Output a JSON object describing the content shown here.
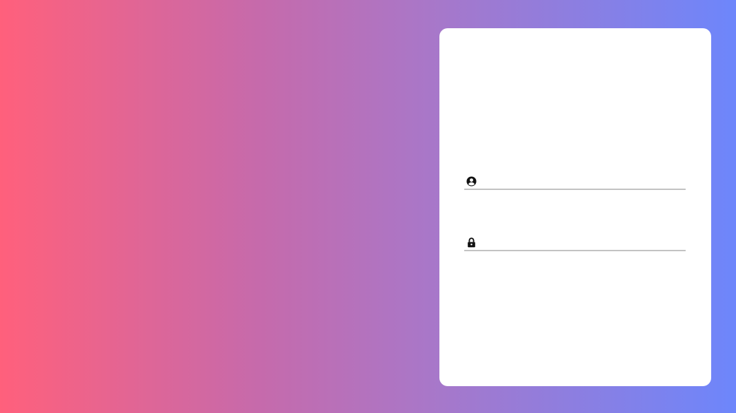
{
  "background": {
    "gradient_colors": [
      "#ff607c",
      "#c66aab",
      "#a977c8",
      "#6d86fb"
    ]
  },
  "login_card": {
    "background_color": "#ffffff",
    "username_field": {
      "icon": "user-circle-icon",
      "value": "",
      "placeholder": ""
    },
    "password_field": {
      "icon": "lock-icon",
      "value": "",
      "placeholder": ""
    },
    "underline_color": "#c2c2c2"
  }
}
